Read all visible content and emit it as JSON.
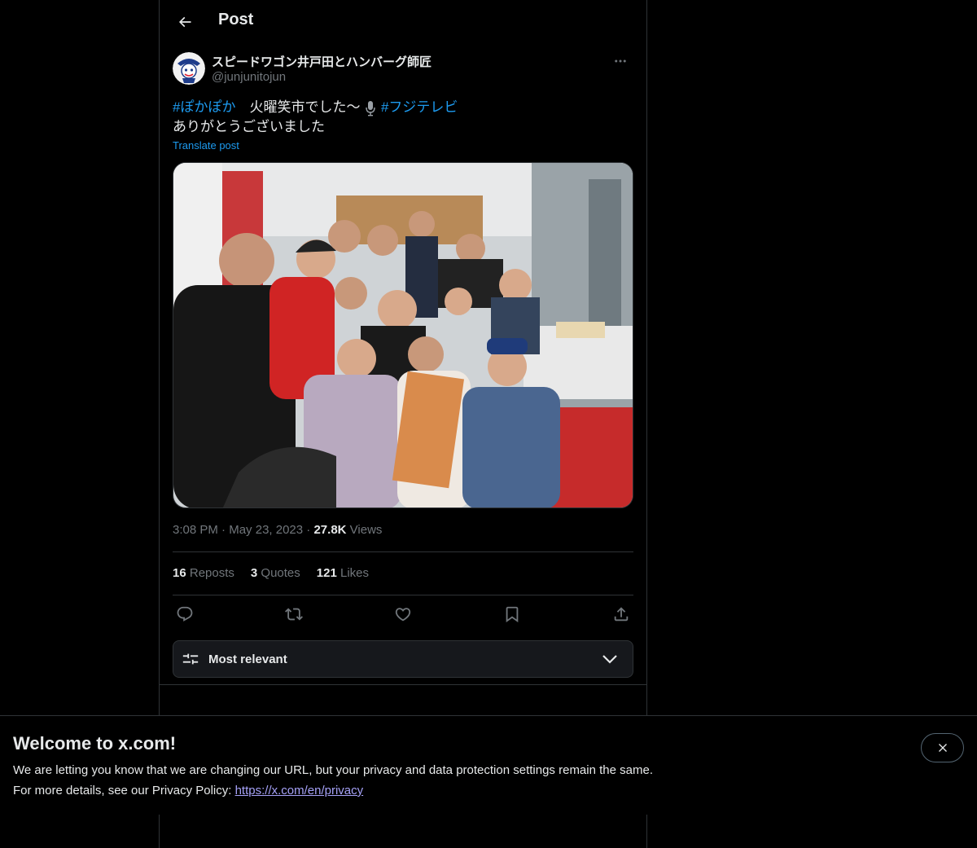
{
  "header": {
    "title": "Post"
  },
  "author": {
    "display_name": "スピードワゴン井戸田とハンバーグ師匠",
    "handle": "@junjunitojun"
  },
  "post": {
    "hashtag1": "#ぽかぽか",
    "text1": "　火曜笑市でした〜",
    "hashtag2": "#フジテレビ",
    "line2": "ありがとうございました",
    "translate_label": "Translate post"
  },
  "meta": {
    "time": "3:08 PM",
    "sep1": "·",
    "date": "May 23, 2023",
    "sep2": "·",
    "views_count": "27.8K",
    "views_label": "Views"
  },
  "stats": {
    "reposts_count": "16",
    "reposts_label": "Reposts",
    "quotes_count": "3",
    "quotes_label": "Quotes",
    "likes_count": "121",
    "likes_label": "Likes"
  },
  "actions": [
    "reply-icon",
    "repost-icon",
    "like-icon",
    "bookmark-icon",
    "share-icon"
  ],
  "sort": {
    "label": "Most relevant"
  },
  "banner": {
    "title": "Welcome to x.com!",
    "line1": "We are letting you know that we are changing our URL, but your privacy and data protection settings remain the same.",
    "line2_prefix": "For more details, see our Privacy Policy: ",
    "link": "https://x.com/en/privacy"
  },
  "colors": {
    "accent": "#1d9bf0",
    "background": "#000000",
    "border": "#2f3336",
    "muted": "#71767b",
    "link": "#a6a2f8"
  }
}
